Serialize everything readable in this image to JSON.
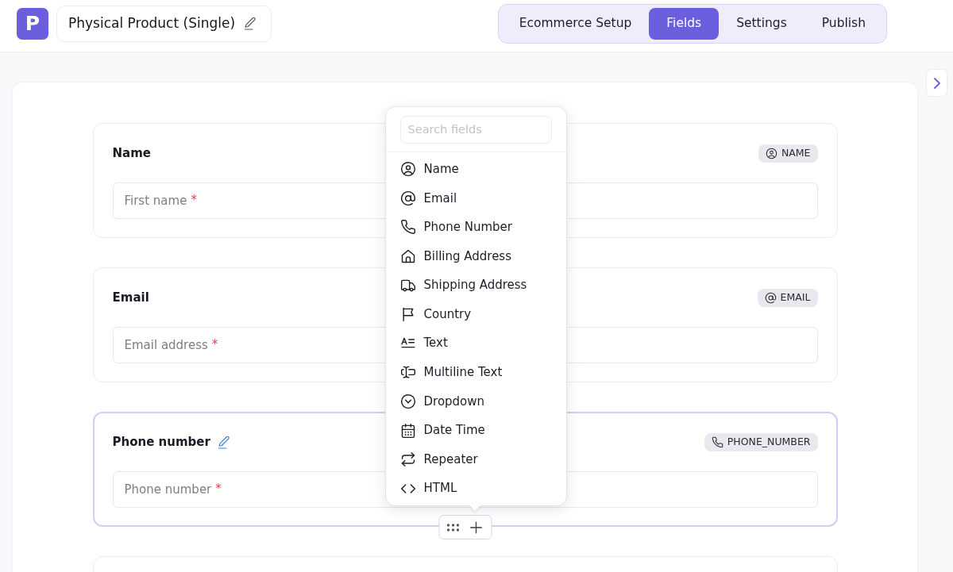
{
  "app_logo": {
    "letter": "P"
  },
  "form_title": {
    "text": "Physical Product (Single)"
  },
  "tabs": [
    {
      "label": "Ecommerce Setup",
      "selected": false
    },
    {
      "label": "Fields",
      "selected": true
    },
    {
      "label": "Settings",
      "selected": false
    },
    {
      "label": "Publish",
      "selected": false
    }
  ],
  "fields": [
    {
      "label": "Name",
      "kind": "name",
      "tag": "NAME",
      "placeholder": "First name",
      "required_mark": "*",
      "selected": false
    },
    {
      "label": "Email",
      "kind": "email",
      "tag": "EMAIL",
      "placeholder": "Email address",
      "required_mark": "*",
      "selected": false
    },
    {
      "label": "Phone number",
      "kind": "phone",
      "tag": "PHONE_NUMBER",
      "placeholder": "Phone number",
      "required_mark": "*",
      "selected": true
    }
  ],
  "field_picker": {
    "search": {
      "placeholder": "Search fields"
    },
    "items": [
      {
        "label": "Name",
        "kind": "name"
      },
      {
        "label": "Email",
        "kind": "email"
      },
      {
        "label": "Phone Number",
        "kind": "phone"
      },
      {
        "label": "Billing Address",
        "kind": "address"
      },
      {
        "label": "Shipping Address",
        "kind": "shipping"
      },
      {
        "label": "Country",
        "kind": "country"
      },
      {
        "label": "Text",
        "kind": "text"
      },
      {
        "label": "Multiline Text",
        "kind": "textarea"
      },
      {
        "label": "Dropdown",
        "kind": "select"
      },
      {
        "label": "Date Time",
        "kind": "datetime"
      },
      {
        "label": "Repeater",
        "kind": "repeater"
      },
      {
        "label": "HTML",
        "kind": "html"
      }
    ]
  }
}
